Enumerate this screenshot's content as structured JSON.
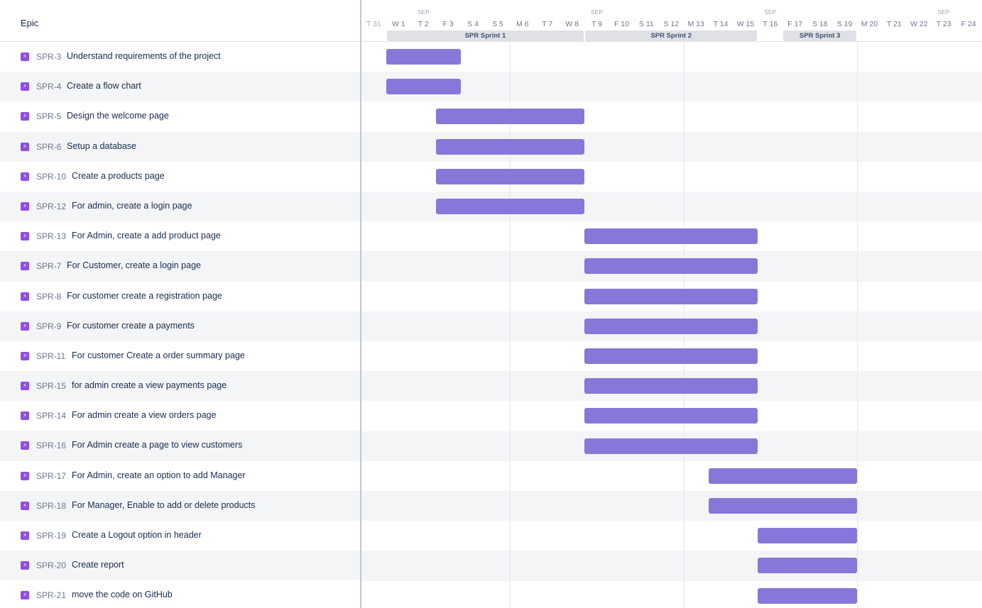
{
  "header": {
    "epic_column": "Epic"
  },
  "timeline": {
    "month": "SEP",
    "month_markers": [
      {
        "day_index": 2
      },
      {
        "day_index": 9
      },
      {
        "day_index": 16
      },
      {
        "day_index": 23
      }
    ],
    "days": [
      "T 31",
      "W 1",
      "T 2",
      "F 3",
      "S 4",
      "S 5",
      "M 6",
      "T 7",
      "W 8",
      "T 9",
      "F 10",
      "S 11",
      "S 12",
      "M 13",
      "T 14",
      "W 15",
      "T 16",
      "F 17",
      "S 18",
      "S 19",
      "M 20",
      "T 21",
      "W 22",
      "T 23",
      "F 24"
    ],
    "sprints": [
      {
        "label": "SPR Sprint 1",
        "start": 1,
        "end": 9
      },
      {
        "label": "SPR Sprint 2",
        "start": 9,
        "end": 16
      },
      {
        "label": "SPR Sprint 3",
        "start": 17,
        "end": 20
      }
    ],
    "week_lines": [
      6,
      13,
      20
    ]
  },
  "epics": [
    {
      "key": "SPR-3",
      "summary": "Understand requirements of the project",
      "start": 1,
      "end": 4
    },
    {
      "key": "SPR-4",
      "summary": "Create a flow chart",
      "start": 1,
      "end": 4
    },
    {
      "key": "SPR-5",
      "summary": "Design the welcome page",
      "start": 3,
      "end": 9
    },
    {
      "key": "SPR-6",
      "summary": "Setup a database",
      "start": 3,
      "end": 9
    },
    {
      "key": "SPR-10",
      "summary": "Create a products page",
      "start": 3,
      "end": 9
    },
    {
      "key": "SPR-12",
      "summary": "For admin, create a login page",
      "start": 3,
      "end": 9
    },
    {
      "key": "SPR-13",
      "summary": "For Admin, create a add product page",
      "start": 9,
      "end": 16
    },
    {
      "key": "SPR-7",
      "summary": "For Customer, create a login page",
      "start": 9,
      "end": 16
    },
    {
      "key": "SPR-8",
      "summary": "For customer create a registration page",
      "start": 9,
      "end": 16
    },
    {
      "key": "SPR-9",
      "summary": "For customer create a payments",
      "start": 9,
      "end": 16
    },
    {
      "key": "SPR-11",
      "summary": "For customer Create a order summary page",
      "start": 9,
      "end": 16
    },
    {
      "key": "SPR-15",
      "summary": "for admin create a view payments page",
      "start": 9,
      "end": 16
    },
    {
      "key": "SPR-14",
      "summary": "For admin create a view orders page",
      "start": 9,
      "end": 16
    },
    {
      "key": "SPR-16",
      "summary": "For Admin create a page to view customers",
      "start": 9,
      "end": 16
    },
    {
      "key": "SPR-17",
      "summary": "For Admin, create an option to add Manager",
      "start": 14,
      "end": 20
    },
    {
      "key": "SPR-18",
      "summary": "For Manager, Enable to add or delete products",
      "start": 14,
      "end": 20
    },
    {
      "key": "SPR-19",
      "summary": "Create a Logout option in header",
      "start": 16,
      "end": 20
    },
    {
      "key": "SPR-20",
      "summary": "Create report",
      "start": 16,
      "end": 20
    },
    {
      "key": "SPR-21",
      "summary": "move the code on GitHub",
      "start": 16,
      "end": 20
    }
  ],
  "colors": {
    "bar": "#8777d9",
    "epic_icon": "#904ee2",
    "row_alt": "#f4f5f7"
  },
  "icons": {
    "epic": "lightning-bolt-icon"
  }
}
